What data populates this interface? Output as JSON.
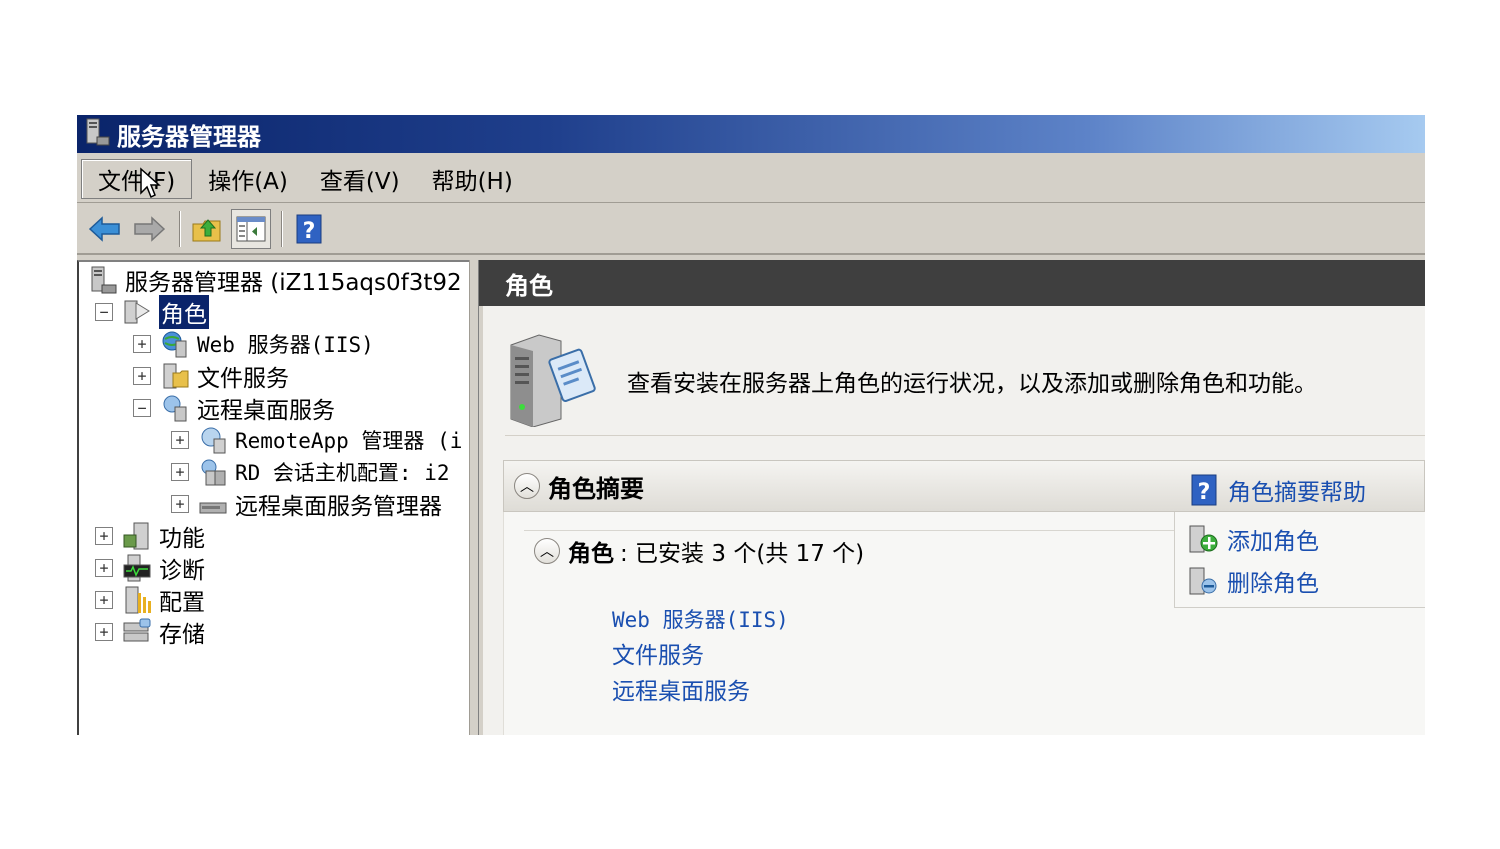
{
  "window": {
    "title": "服务器管理器"
  },
  "menu": {
    "items": [
      "文件(F)",
      "操作(A)",
      "查看(V)",
      "帮助(H)"
    ]
  },
  "toolbar": {
    "icons": [
      "back-icon",
      "forward-icon",
      "up-folder-icon",
      "show-hide-tree-icon",
      "help-icon"
    ]
  },
  "tree": {
    "root": "服务器管理器 (iZ115aqs0f3t92",
    "roles": "角色",
    "web_server": "Web 服务器(IIS)",
    "file_services": "文件服务",
    "rds": "远程桌面服务",
    "remoteapp": "RemoteApp 管理器 (i",
    "rd_session": "RD 会话主机配置: i2",
    "rds_manager": "远程桌面服务管理器",
    "features": "功能",
    "diagnostics": "诊断",
    "configuration": "配置",
    "storage": "存储"
  },
  "right": {
    "header": "角色",
    "intro": "查看安装在服务器上角色的运行状况，以及添加或删除角色和功能。",
    "summary_title": "角色摘要",
    "summary_help": "角色摘要帮助",
    "roles_label": "角色",
    "roles_count": ": 已安装 3 个(共 17 个)",
    "installed_roles": [
      "Web 服务器(IIS)",
      "文件服务",
      "远程桌面服务"
    ],
    "actions": {
      "add_role": "添加角色",
      "remove_role": "删除角色"
    }
  },
  "colors": {
    "title_bar": "#0a246a",
    "link": "#1a4fb0",
    "pane_header": "#3f3f3f",
    "selection": "#0a246a"
  }
}
